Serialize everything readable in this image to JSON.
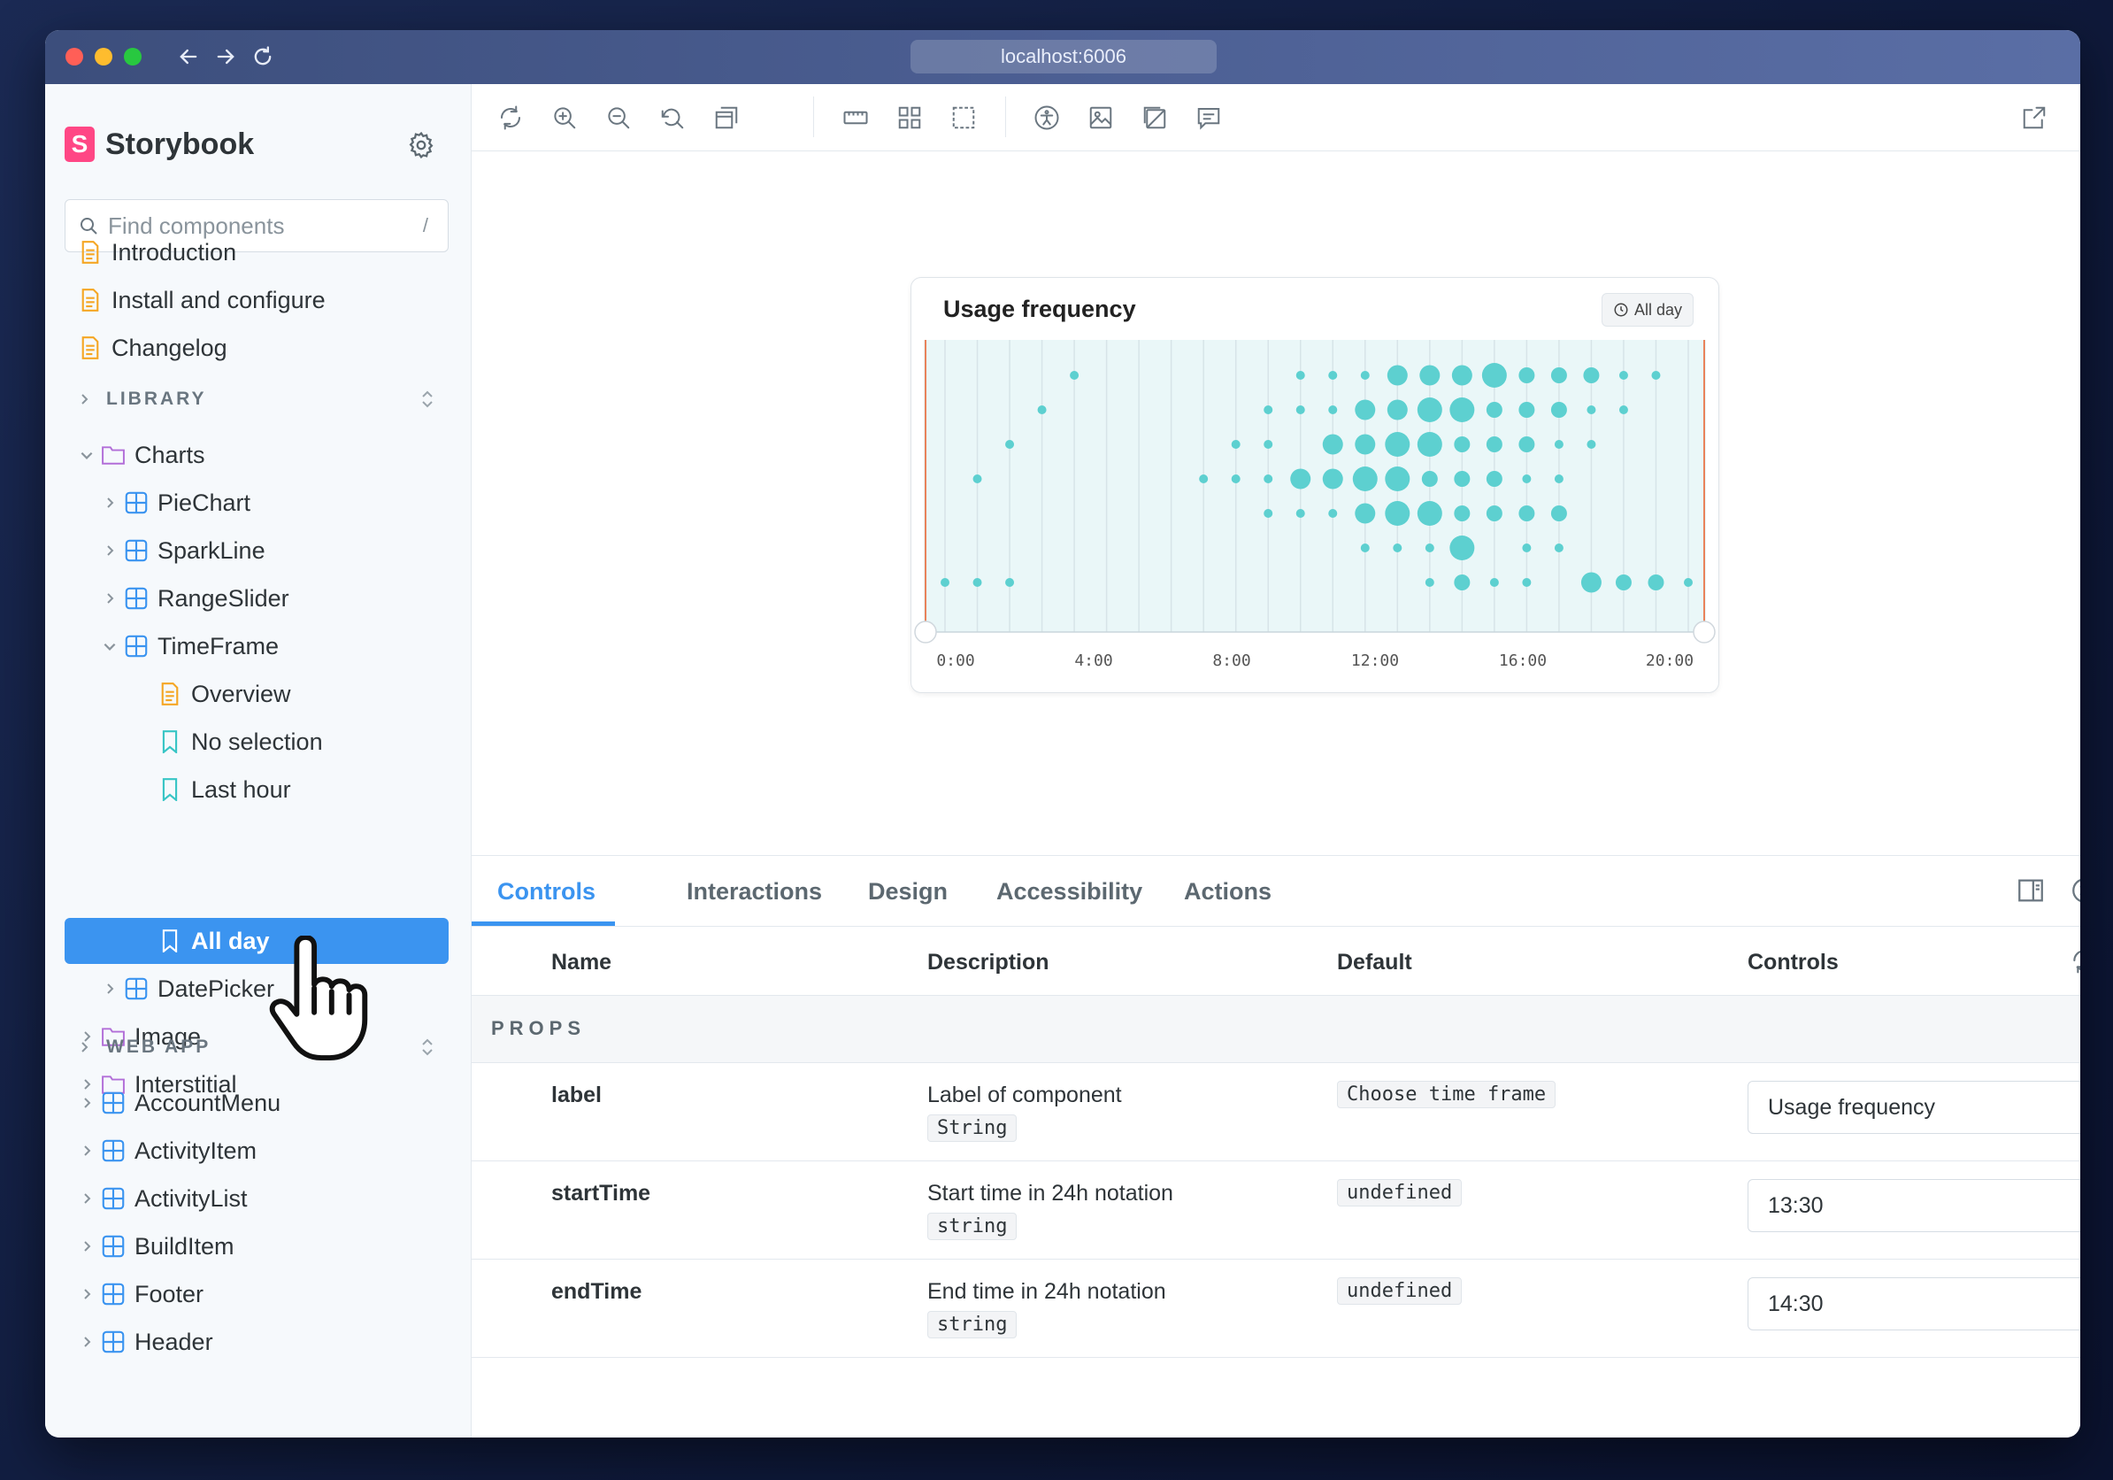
{
  "browser": {
    "url": "localhost:6006"
  },
  "sidebar": {
    "brand": "Storybook",
    "search_placeholder": "Find components",
    "search_shortcut": "/",
    "docs": [
      {
        "label": "Introduction",
        "icon": "document-icon"
      },
      {
        "label": "Install and configure",
        "icon": "document-icon"
      },
      {
        "label": "Changelog",
        "icon": "document-icon"
      }
    ],
    "sections": [
      {
        "title": "LIBRARY"
      },
      {
        "title": "WEB APP"
      }
    ],
    "library": {
      "charts_folder": "Charts",
      "charts_children": [
        "PieChart",
        "SparkLine",
        "RangeSlider",
        "TimeFrame"
      ],
      "timeframe_children": [
        "Overview",
        "No selection",
        "Last hour",
        "All day"
      ],
      "after_timeframe": "DatePicker",
      "folders": [
        "Image",
        "Interstitial"
      ]
    },
    "webapp": [
      "AccountMenu",
      "ActivityItem",
      "ActivityList",
      "BuildItem",
      "Footer",
      "Header"
    ],
    "selected": "All day",
    "colors": {
      "accent": "#3b94f0",
      "brand": "#ff4785",
      "folder": "#b26ed8",
      "component": "#3b94f0",
      "doc": "#f5a623",
      "story": "#37c5c5"
    }
  },
  "preview": {
    "card_title": "Usage frequency",
    "chip_label": "All day"
  },
  "chart_data": {
    "type": "scatter",
    "title": "Usage frequency",
    "x_ticks": [
      "0:00",
      "4:00",
      "8:00",
      "12:00",
      "16:00",
      "20:00"
    ],
    "xlim": [
      0,
      23
    ],
    "rows": 7,
    "series": [
      {
        "name": "",
        "points": [
          [
            4,
            0,
            1
          ],
          [
            11,
            0,
            1
          ],
          [
            12,
            0,
            1
          ],
          [
            13,
            0,
            1
          ],
          [
            14,
            0,
            3
          ],
          [
            15,
            0,
            3
          ],
          [
            16,
            0,
            3
          ],
          [
            17,
            0,
            4
          ],
          [
            18,
            0,
            2
          ],
          [
            19,
            0,
            2
          ],
          [
            20,
            0,
            2
          ],
          [
            21,
            0,
            1
          ],
          [
            22,
            0,
            1
          ],
          [
            3,
            1,
            1
          ],
          [
            10,
            1,
            1
          ],
          [
            11,
            1,
            1
          ],
          [
            12,
            1,
            1
          ],
          [
            13,
            1,
            3
          ],
          [
            14,
            1,
            3
          ],
          [
            15,
            1,
            4
          ],
          [
            16,
            1,
            4
          ],
          [
            17,
            1,
            2
          ],
          [
            18,
            1,
            2
          ],
          [
            19,
            1,
            2
          ],
          [
            20,
            1,
            1
          ],
          [
            21,
            1,
            1
          ],
          [
            2,
            2,
            1
          ],
          [
            9,
            2,
            1
          ],
          [
            10,
            2,
            1
          ],
          [
            12,
            2,
            3
          ],
          [
            13,
            2,
            3
          ],
          [
            14,
            2,
            4
          ],
          [
            15,
            2,
            4
          ],
          [
            16,
            2,
            2
          ],
          [
            17,
            2,
            2
          ],
          [
            18,
            2,
            2
          ],
          [
            19,
            2,
            1
          ],
          [
            20,
            2,
            1
          ],
          [
            1,
            3,
            1
          ],
          [
            8,
            3,
            1
          ],
          [
            9,
            3,
            1
          ],
          [
            10,
            3,
            1
          ],
          [
            11,
            3,
            3
          ],
          [
            12,
            3,
            3
          ],
          [
            13,
            3,
            4
          ],
          [
            14,
            3,
            4
          ],
          [
            15,
            3,
            2
          ],
          [
            16,
            3,
            2
          ],
          [
            17,
            3,
            2
          ],
          [
            18,
            3,
            1
          ],
          [
            19,
            3,
            1
          ],
          [
            10,
            4,
            1
          ],
          [
            11,
            4,
            1
          ],
          [
            12,
            4,
            1
          ],
          [
            13,
            4,
            3
          ],
          [
            14,
            4,
            4
          ],
          [
            15,
            4,
            4
          ],
          [
            16,
            4,
            2
          ],
          [
            17,
            4,
            2
          ],
          [
            18,
            4,
            2
          ],
          [
            19,
            4,
            2
          ],
          [
            13,
            5,
            1
          ],
          [
            14,
            5,
            1
          ],
          [
            15,
            5,
            1
          ],
          [
            16,
            5,
            4
          ],
          [
            18,
            5,
            1
          ],
          [
            19,
            5,
            1
          ],
          [
            0,
            6,
            1
          ],
          [
            1,
            6,
            1
          ],
          [
            2,
            6,
            1
          ],
          [
            15,
            6,
            1
          ],
          [
            16,
            6,
            2
          ],
          [
            17,
            6,
            1
          ],
          [
            18,
            6,
            1
          ],
          [
            20,
            6,
            3
          ],
          [
            21,
            6,
            2
          ],
          [
            22,
            6,
            2
          ],
          [
            23,
            6,
            1
          ]
        ]
      }
    ],
    "grid": true,
    "range_handles": [
      "0:00",
      "23:00"
    ],
    "colors": {
      "dot": "#5dd0d0",
      "grid": "#d7e4e8",
      "range": "#e9825a",
      "background": "#eaf7f8"
    }
  },
  "addons": {
    "tabs": [
      "Controls",
      "Interactions",
      "Design",
      "Accessibility",
      "Actions"
    ],
    "active_tab": "Controls",
    "columns": [
      "Name",
      "Description",
      "Default",
      "Controls"
    ],
    "props_label": "PROPS",
    "rows": [
      {
        "name": "label",
        "description": "Label of component",
        "type": "String",
        "default": "Choose time frame",
        "value": "Usage frequency"
      },
      {
        "name": "startTime",
        "description": "Start time in 24h notation",
        "type": "string",
        "default": "undefined",
        "value": "13:30"
      },
      {
        "name": "endTime",
        "description": "End time in 24h notation",
        "type": "string",
        "default": "undefined",
        "value": "14:30"
      }
    ]
  }
}
